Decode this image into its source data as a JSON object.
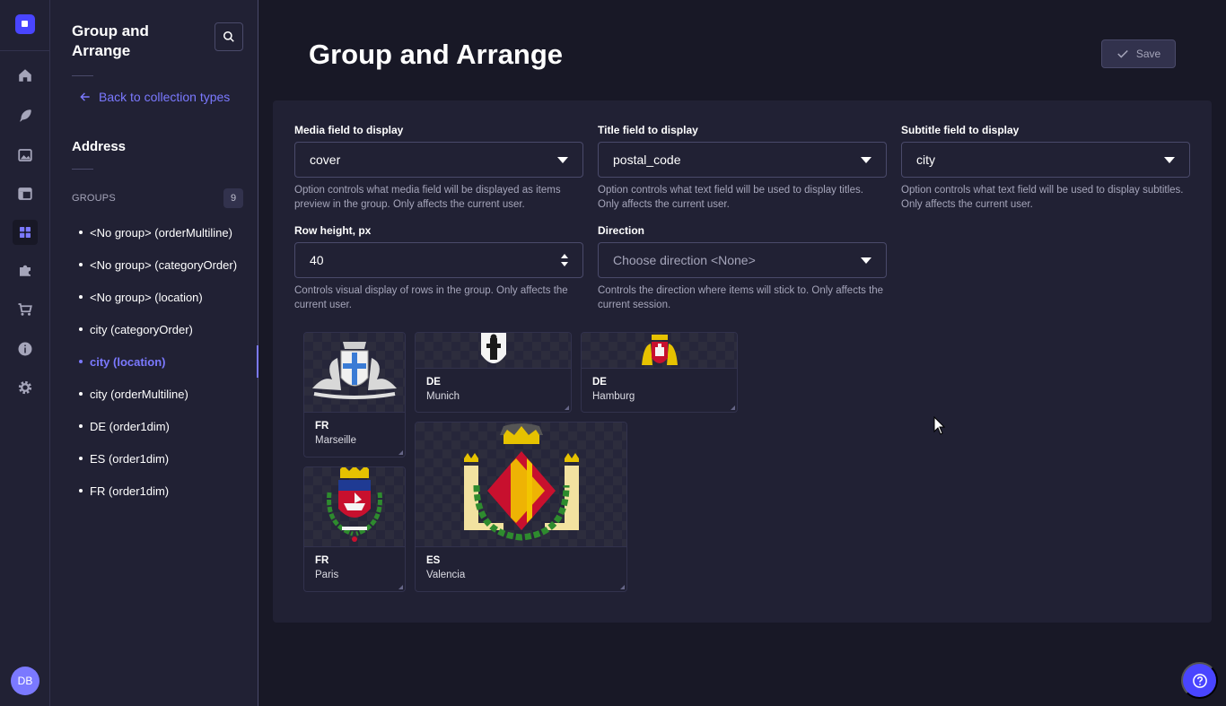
{
  "subnav": {
    "title": "Group and Arrange",
    "back_link": "Back to collection types",
    "section_title": "Address",
    "groups_label": "GROUPS",
    "groups_count": "9",
    "groups": [
      "<No group> (orderMultiline)",
      "<No group> (categoryOrder)",
      "<No group> (location)",
      "city (categoryOrder)",
      "city (location)",
      "city (orderMultiline)",
      "DE (order1dim)",
      "ES (order1dim)",
      "FR (order1dim)"
    ],
    "active_group": "city (location)"
  },
  "header": {
    "title": "Group and Arrange",
    "save_label": "Save"
  },
  "settings": {
    "media": {
      "label": "Media field to display",
      "value": "cover",
      "hint": "Option controls what media field will be displayed as items preview in the group. Only affects the current user."
    },
    "title_field": {
      "label": "Title field to display",
      "value": "postal_code",
      "hint": "Option controls what text field will be used to display titles. Only affects the current user."
    },
    "subtitle_field": {
      "label": "Subtitle field to display",
      "value": "city",
      "hint": "Option controls what text field will be used to display subtitles. Only affects the current user."
    },
    "row_height": {
      "label": "Row height, px",
      "value": "40",
      "hint": "Controls visual display of rows in the group. Only affects the current user."
    },
    "direction": {
      "label": "Direction",
      "placeholder": "Choose direction <None>",
      "hint": "Controls the direction where items will stick to. Only affects the current session."
    }
  },
  "cards": [
    {
      "title": "FR",
      "subtitle": "Marseille",
      "icon": "marseille-coat-of-arms-icon"
    },
    {
      "title": "DE",
      "subtitle": "Munich",
      "icon": "munich-coat-of-arms-icon"
    },
    {
      "title": "DE",
      "subtitle": "Hamburg",
      "icon": "hamburg-coat-of-arms-icon"
    },
    {
      "title": "ES",
      "subtitle": "Valencia",
      "icon": "valencia-coat-of-arms-icon"
    },
    {
      "title": "FR",
      "subtitle": "Paris",
      "icon": "paris-coat-of-arms-icon"
    }
  ],
  "user": {
    "initials": "DB"
  },
  "colors": {
    "accent": "#4945ff",
    "accent_text": "#7b79ff",
    "background": "#181826",
    "panel": "#212134"
  }
}
